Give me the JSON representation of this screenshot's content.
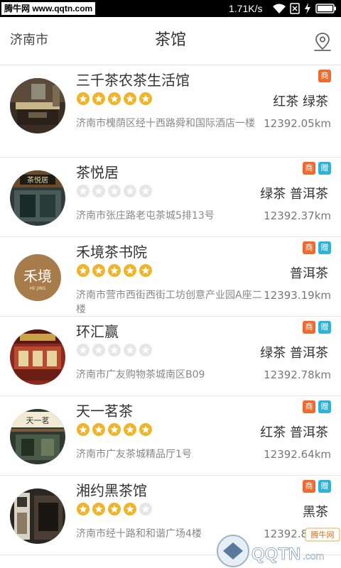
{
  "status_bar": {
    "watermark_text": "腾牛网 www.qqtn.com",
    "net_speed": "1.71K/s",
    "icons": [
      "wifi-icon",
      "sim-icon",
      "charging-icon",
      "battery-icon"
    ]
  },
  "header": {
    "city": "济南市",
    "title": "茶馆",
    "location_icon": "location-pin-icon"
  },
  "colors": {
    "star_on": "#f0b42a",
    "star_off": "#e6e6e6",
    "badge_shang": "#ef6a2c",
    "badge_zeng": "#2fb2d8"
  },
  "shops": [
    {
      "name": "三千茶农茶生活馆",
      "rating": 5,
      "badges": [
        "商"
      ],
      "teas": "红茶 绿茶",
      "address": "济南市槐荫区经十西路舜和国际酒店一楼",
      "distance": "12392.05km"
    },
    {
      "name": "茶悦居",
      "rating": 0,
      "badges": [
        "商",
        "赠"
      ],
      "teas": "绿茶 普洱茶",
      "address": "济南市张庄路老屯茶城5排13号",
      "distance": "12392.37km",
      "sign_text": "茶悦居"
    },
    {
      "name": "禾境茶书院",
      "rating": 5,
      "badges": [
        "商",
        "赠"
      ],
      "teas": "普洱茶",
      "address": "济南市营市西街西街工坊创意产业园A座二楼",
      "distance": "12393.19km",
      "logo_text": "禾境",
      "logo_sub": "HE JING"
    },
    {
      "name": "环汇赢",
      "rating": 0,
      "badges": [
        "商",
        "赠"
      ],
      "teas": "绿茶 普洱茶",
      "address": "济南市广友购物茶城南区B09",
      "distance": "12392.78km"
    },
    {
      "name": "天一茗茶",
      "rating": 5,
      "badges": [
        "商",
        "赠"
      ],
      "teas": "红茶 普洱茶",
      "address": "济南市广友茶城精品厅1号",
      "distance": "12392.64km",
      "sign_text": "天一茗"
    },
    {
      "name": "湘约黑茶馆",
      "rating": 4,
      "badges": [
        "商",
        "赠"
      ],
      "teas": "黑茶",
      "address": "济南市经十路和和谐广场4楼",
      "distance": "12392.80km"
    }
  ],
  "corner_watermark": {
    "logo_text": "QQTN",
    "suffix": ".com",
    "badge": "腾牛网"
  }
}
